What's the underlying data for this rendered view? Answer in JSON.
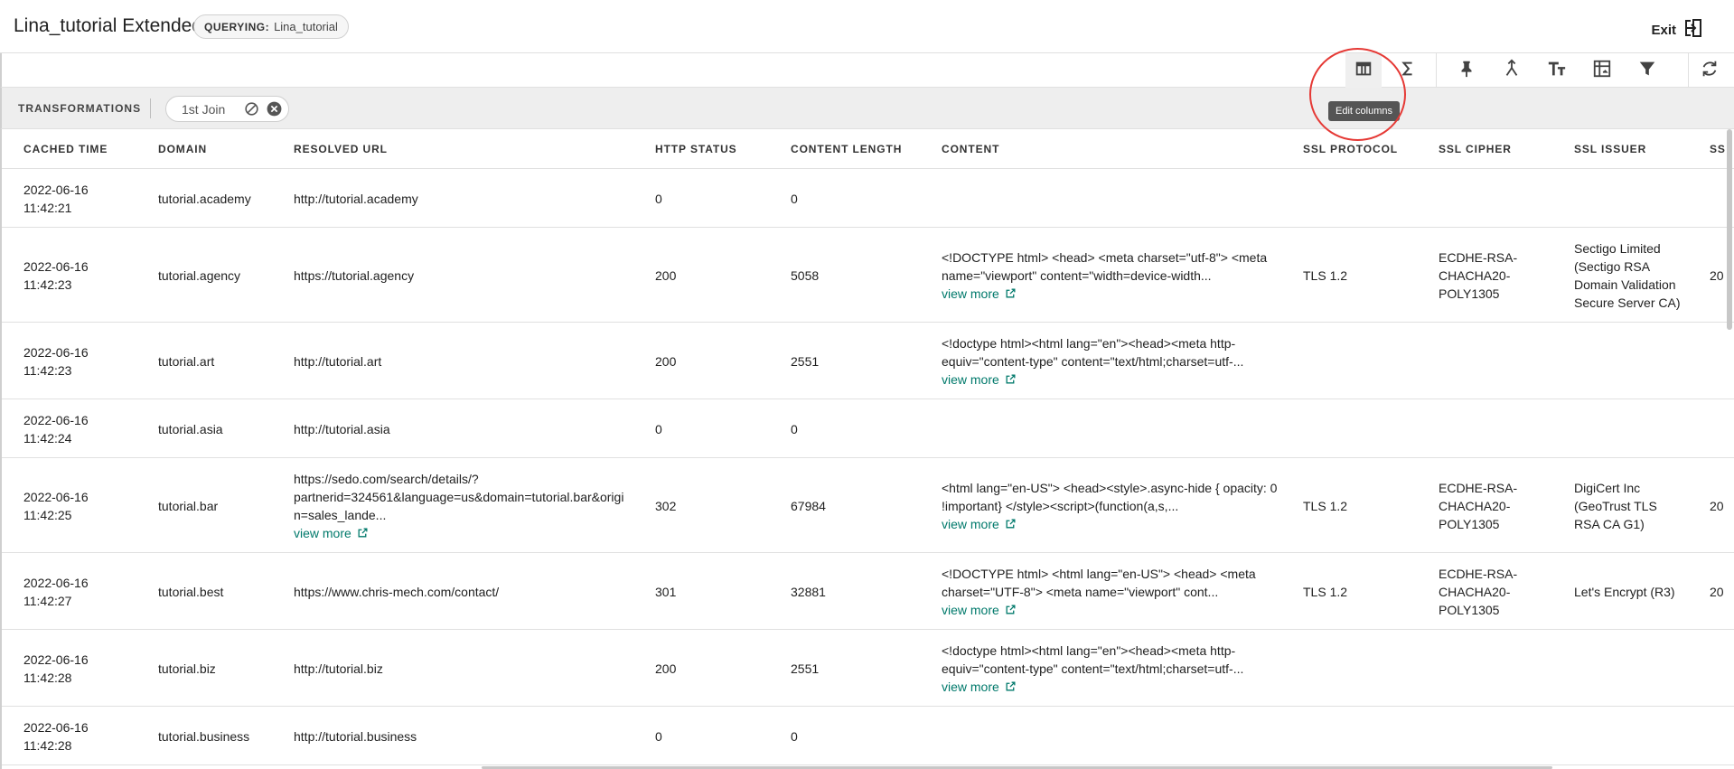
{
  "header": {
    "title": "Lina_tutorial Extended",
    "query_key": "QUERYING:",
    "query_value": "Lina_tutorial",
    "exit_label": "Exit"
  },
  "toolbar": {
    "tooltip": "Edit columns",
    "buttons": [
      "table-columns-icon",
      "sigma-icon",
      "pin-icon",
      "merge-icon",
      "text-size-icon",
      "pivot-icon",
      "filter-icon",
      "refresh-icon"
    ]
  },
  "transformations": {
    "label": "TRANSFORMATIONS",
    "chip_label": "1st Join"
  },
  "table": {
    "columns": [
      "CACHED TIME",
      "DOMAIN",
      "RESOLVED URL",
      "HTTP STATUS",
      "CONTENT LENGTH",
      "CONTENT",
      "SSL PROTOCOL",
      "SSL CIPHER",
      "SSL ISSUER",
      "SS"
    ],
    "view_more_label": "view more",
    "rows": [
      {
        "time": [
          "2022-06-16",
          "11:42:21"
        ],
        "domain": "tutorial.academy",
        "url": [
          "http://tutorial.academy"
        ],
        "url_more": false,
        "status": "0",
        "length": "0",
        "content": [],
        "content_more": false,
        "protocol": "",
        "cipher": [],
        "issuer": [],
        "extra": ""
      },
      {
        "time": [
          "2022-06-16",
          "11:42:23"
        ],
        "domain": "tutorial.agency",
        "url": [
          "https://tutorial.agency"
        ],
        "url_more": false,
        "status": "200",
        "length": "5058",
        "content": [
          "<!DOCTYPE html> <head> <meta charset=\"utf-8\"> <meta",
          "name=\"viewport\" content=\"width=device-width..."
        ],
        "content_more": true,
        "protocol": "TLS 1.2",
        "cipher": [
          "ECDHE-RSA-",
          "CHACHA20-",
          "POLY1305"
        ],
        "issuer": [
          "Sectigo Limited",
          "(Sectigo RSA",
          "Domain Validation",
          "Secure Server CA)"
        ],
        "extra": "20"
      },
      {
        "time": [
          "2022-06-16",
          "11:42:23"
        ],
        "domain": "tutorial.art",
        "url": [
          "http://tutorial.art"
        ],
        "url_more": false,
        "status": "200",
        "length": "2551",
        "content": [
          "<!doctype html><html lang=\"en\"><head><meta http-",
          "equiv=\"content-type\" content=\"text/html;charset=utf-..."
        ],
        "content_more": true,
        "protocol": "",
        "cipher": [],
        "issuer": [],
        "extra": ""
      },
      {
        "time": [
          "2022-06-16",
          "11:42:24"
        ],
        "domain": "tutorial.asia",
        "url": [
          "http://tutorial.asia"
        ],
        "url_more": false,
        "status": "0",
        "length": "0",
        "content": [],
        "content_more": false,
        "protocol": "",
        "cipher": [],
        "issuer": [],
        "extra": ""
      },
      {
        "time": [
          "2022-06-16",
          "11:42:25"
        ],
        "domain": "tutorial.bar",
        "url": [
          "https://sedo.com/search/details/?",
          "partnerid=324561&language=us&domain=tutorial.bar&origi",
          "n=sales_lande..."
        ],
        "url_more": true,
        "status": "302",
        "length": "67984",
        "content": [
          "<html lang=\"en-US\"> <head><style>.async-hide { opacity: 0",
          "!important} </style><script>(function(a,s,..."
        ],
        "content_more": true,
        "protocol": "TLS 1.2",
        "cipher": [
          "ECDHE-RSA-",
          "CHACHA20-",
          "POLY1305"
        ],
        "issuer": [
          "DigiCert Inc",
          "(GeoTrust TLS",
          "RSA CA G1)"
        ],
        "extra": "20"
      },
      {
        "time": [
          "2022-06-16",
          "11:42:27"
        ],
        "domain": "tutorial.best",
        "url": [
          "https://www.chris-mech.com/contact/"
        ],
        "url_more": false,
        "status": "301",
        "length": "32881",
        "content": [
          "<!DOCTYPE html> <html lang=\"en-US\"> <head> <meta",
          "charset=\"UTF-8\"> <meta name=\"viewport\" cont..."
        ],
        "content_more": true,
        "protocol": "TLS 1.2",
        "cipher": [
          "ECDHE-RSA-",
          "CHACHA20-",
          "POLY1305"
        ],
        "issuer": [
          "Let's Encrypt (R3)"
        ],
        "extra": "20"
      },
      {
        "time": [
          "2022-06-16",
          "11:42:28"
        ],
        "domain": "tutorial.biz",
        "url": [
          "http://tutorial.biz"
        ],
        "url_more": false,
        "status": "200",
        "length": "2551",
        "content": [
          "<!doctype html><html lang=\"en\"><head><meta http-",
          "equiv=\"content-type\" content=\"text/html;charset=utf-..."
        ],
        "content_more": true,
        "protocol": "",
        "cipher": [],
        "issuer": [],
        "extra": ""
      },
      {
        "time": [
          "2022-06-16",
          "11:42:28"
        ],
        "domain": "tutorial.business",
        "url": [
          "http://tutorial.business"
        ],
        "url_more": false,
        "status": "0",
        "length": "0",
        "content": [],
        "content_more": false,
        "protocol": "",
        "cipher": [],
        "issuer": [],
        "extra": ""
      }
    ]
  }
}
